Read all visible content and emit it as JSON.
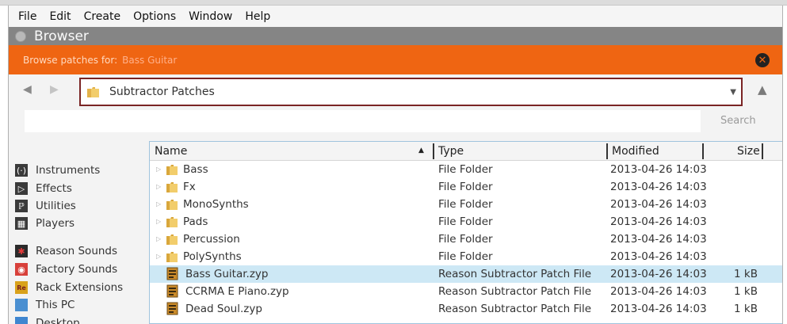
{
  "menu": [
    "File",
    "Edit",
    "Create",
    "Options",
    "Window",
    "Help"
  ],
  "window": {
    "title": "Browser"
  },
  "browse_bar": {
    "prefix": "Browse patches for:",
    "target": "Bass Guitar"
  },
  "path": {
    "current": "Subtractor Patches"
  },
  "search": {
    "value": "",
    "button": "Search"
  },
  "sidebar": {
    "items": [
      {
        "label": "Instruments",
        "icon": "instruments-icon"
      },
      {
        "label": "Effects",
        "icon": "effects-icon"
      },
      {
        "label": "Utilities",
        "icon": "utilities-icon"
      },
      {
        "label": "Players",
        "icon": "players-icon"
      },
      {
        "label": "Reason Sounds",
        "icon": "reason-sounds-icon"
      },
      {
        "label": "Factory Sounds",
        "icon": "factory-sounds-icon"
      },
      {
        "label": "Rack Extensions",
        "icon": "rack-extensions-icon"
      },
      {
        "label": "This PC",
        "icon": "pc-icon"
      },
      {
        "label": "Desktop",
        "icon": "desktop-icon"
      }
    ]
  },
  "columns": {
    "name": "Name",
    "type": "Type",
    "modified": "Modified",
    "size": "Size"
  },
  "rows": [
    {
      "name": "Bass",
      "type": "File Folder",
      "modified": "2013-04-26 14:03",
      "size": "",
      "kind": "folder"
    },
    {
      "name": "Fx",
      "type": "File Folder",
      "modified": "2013-04-26 14:03",
      "size": "",
      "kind": "folder"
    },
    {
      "name": "MonoSynths",
      "type": "File Folder",
      "modified": "2013-04-26 14:03",
      "size": "",
      "kind": "folder"
    },
    {
      "name": "Pads",
      "type": "File Folder",
      "modified": "2013-04-26 14:03",
      "size": "",
      "kind": "folder"
    },
    {
      "name": "Percussion",
      "type": "File Folder",
      "modified": "2013-04-26 14:03",
      "size": "",
      "kind": "folder"
    },
    {
      "name": "PolySynths",
      "type": "File Folder",
      "modified": "2013-04-26 14:03",
      "size": "",
      "kind": "folder"
    },
    {
      "name": "Bass Guitar.zyp",
      "type": "Reason Subtractor Patch File",
      "modified": "2013-04-26 14:03",
      "size": "1 kB",
      "kind": "file",
      "selected": true
    },
    {
      "name": "CCRMA E Piano.zyp",
      "type": "Reason Subtractor Patch File",
      "modified": "2013-04-26 14:03",
      "size": "1 kB",
      "kind": "file"
    },
    {
      "name": "Dead Soul.zyp",
      "type": "Reason Subtractor Patch File",
      "modified": "2013-04-26 14:03",
      "size": "1 kB",
      "kind": "file"
    }
  ],
  "colors": {
    "accent": "#ef6512",
    "selection": "#cde8f5",
    "path_border": "#7a2424"
  }
}
